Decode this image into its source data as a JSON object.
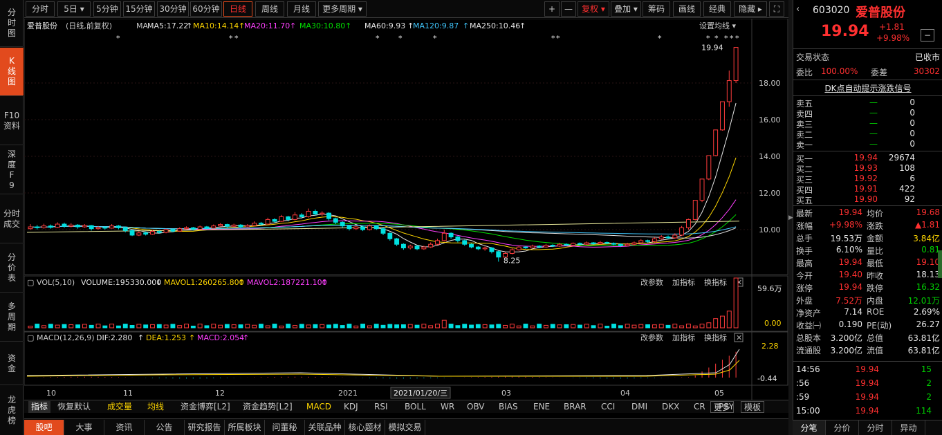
{
  "left_tabs": [
    {
      "label": "分时图"
    },
    {
      "label": "K线图"
    },
    {
      "label": "F10资料"
    },
    {
      "label": "深度F9"
    },
    {
      "label": "分时成交"
    },
    {
      "label": "分价表"
    },
    {
      "label": "多周期"
    },
    {
      "label": "资金"
    },
    {
      "label": "龙虎榜"
    }
  ],
  "periods": [
    {
      "label": "分时"
    },
    {
      "label": "5日 ▾"
    },
    {
      "label": "5分钟"
    },
    {
      "label": "15分钟"
    },
    {
      "label": "30分钟"
    },
    {
      "label": "60分钟"
    },
    {
      "label": "日线"
    },
    {
      "label": "周线"
    },
    {
      "label": "月线"
    },
    {
      "label": "更多周期 ▾"
    }
  ],
  "toolbar": [
    {
      "label": "+"
    },
    {
      "label": "—"
    },
    {
      "label": "复权 ▾"
    },
    {
      "label": "叠加 ▾"
    },
    {
      "label": "筹码"
    },
    {
      "label": "画线"
    },
    {
      "label": "经典"
    },
    {
      "label": "隐藏 ▸"
    },
    {
      "label": "⛶"
    }
  ],
  "kline_header": {
    "name": "爱普股份",
    "mode": "(日线,前复权)",
    "ma_label": "MA",
    "ma": [
      {
        "label": "MA5:17.22",
        "color": "#e6e6e6"
      },
      {
        "label": "MA10:14.14",
        "color": "#ffd700"
      },
      {
        "label": "MA20:11.70",
        "color": "#ff40ff"
      },
      {
        "label": "MA30:10.80",
        "color": "#00e000"
      },
      {
        "label": "MA60:9.93",
        "color": "#e6e6e6"
      },
      {
        "label": "MA120:9.87",
        "color": "#40c8ff"
      },
      {
        "label": "MA250:10.46",
        "color": "#e6e6e6"
      }
    ],
    "setting": "设置均线 ▾"
  },
  "price_axis": [
    "18.00",
    "16.00",
    "14.00",
    "12.00",
    "10.00"
  ],
  "annotations": {
    "high": "19.94",
    "low": "8.25"
  },
  "vol_header": {
    "prefix": "VOL(5,10)",
    "volume": "VOLUME:195330.000",
    "mavol1": "MAVOL1:260265.800",
    "mavol2": "MAVOL2:187221.100",
    "axis_top": "59.6万",
    "axis_bottom": "0.00",
    "actions": [
      "改参数",
      "加指标",
      "换指标"
    ]
  },
  "macd_header": {
    "prefix": "MACD(12,26,9)",
    "dif": "DIF:2.280",
    "dea": "DEA:1.253",
    "macd": "MACD:2.054",
    "axis_top": "2.28",
    "axis_bottom": "-0.44",
    "actions": [
      "改参数",
      "加指标",
      "换指标"
    ]
  },
  "time_axis": [
    "10",
    "11",
    "12",
    "2021",
    "03",
    "04",
    "05"
  ],
  "time_cursor": "2021/01/20/三",
  "chart_data": {
    "type": "candlestick",
    "kline": [
      [
        10.05,
        10.15,
        10.3,
        9.98
      ],
      [
        10.15,
        10.1,
        10.25,
        10.0
      ],
      [
        10.1,
        10.2,
        10.32,
        10.05
      ],
      [
        10.2,
        10.12,
        10.28,
        10.05
      ],
      [
        10.12,
        10.3,
        10.4,
        10.08
      ],
      [
        10.3,
        10.18,
        10.38,
        10.1
      ],
      [
        10.18,
        10.25,
        10.35,
        10.12
      ],
      [
        10.25,
        10.15,
        10.3,
        10.05
      ],
      [
        10.15,
        10.22,
        10.3,
        10.1
      ],
      [
        10.22,
        10.05,
        10.25,
        9.95
      ],
      [
        10.05,
        10.12,
        10.2,
        10.0
      ],
      [
        10.12,
        10.08,
        10.18,
        10.0
      ],
      [
        10.08,
        10.2,
        10.3,
        10.05
      ],
      [
        10.2,
        10.1,
        10.25,
        10.02
      ],
      [
        10.1,
        9.95,
        10.15,
        9.85
      ],
      [
        9.95,
        9.7,
        10.0,
        9.65
      ],
      [
        9.7,
        9.82,
        9.9,
        9.65
      ],
      [
        9.82,
        9.75,
        9.9,
        9.68
      ],
      [
        9.75,
        9.9,
        9.98,
        9.72
      ],
      [
        9.9,
        9.85,
        9.95,
        9.78
      ],
      [
        9.85,
        10.0,
        10.05,
        9.8
      ],
      [
        10.0,
        9.92,
        10.05,
        9.85
      ],
      [
        9.92,
        10.05,
        10.12,
        9.88
      ],
      [
        10.05,
        10.1,
        10.18,
        10.0
      ],
      [
        10.1,
        10.02,
        10.15,
        9.95
      ],
      [
        10.02,
        10.15,
        10.22,
        10.0
      ],
      [
        10.15,
        10.08,
        10.2,
        10.02
      ],
      [
        10.08,
        10.2,
        10.28,
        10.05
      ],
      [
        10.2,
        10.28,
        10.35,
        10.15
      ],
      [
        10.28,
        10.18,
        10.32,
        10.1
      ],
      [
        10.18,
        10.25,
        10.32,
        10.12
      ],
      [
        10.25,
        10.15,
        10.3,
        10.08
      ],
      [
        10.15,
        10.22,
        10.3,
        10.1
      ],
      [
        10.22,
        10.35,
        10.45,
        10.18
      ],
      [
        10.35,
        10.3,
        10.42,
        10.22
      ],
      [
        10.3,
        10.55,
        10.65,
        10.28
      ],
      [
        10.55,
        10.45,
        10.62,
        10.38
      ],
      [
        10.45,
        10.7,
        10.8,
        10.42
      ],
      [
        10.7,
        10.55,
        10.75,
        10.45
      ],
      [
        10.55,
        10.8,
        10.95,
        10.5
      ],
      [
        10.8,
        10.7,
        10.9,
        10.6
      ],
      [
        10.7,
        11.0,
        11.15,
        10.65
      ],
      [
        11.0,
        10.85,
        11.1,
        10.78
      ],
      [
        10.85,
        10.9,
        11.0,
        10.75
      ],
      [
        10.9,
        10.6,
        10.95,
        10.5
      ],
      [
        10.6,
        10.4,
        10.65,
        10.3
      ],
      [
        10.4,
        10.2,
        10.45,
        10.1
      ],
      [
        10.2,
        10.05,
        10.25,
        9.95
      ],
      [
        10.05,
        10.15,
        10.22,
        9.98
      ],
      [
        10.15,
        10.0,
        10.2,
        9.92
      ],
      [
        10.0,
        10.2,
        10.28,
        9.95
      ],
      [
        10.2,
        10.05,
        10.25,
        9.98
      ],
      [
        10.05,
        9.8,
        10.1,
        9.7
      ],
      [
        9.8,
        9.5,
        9.85,
        9.4
      ],
      [
        9.5,
        9.2,
        9.55,
        9.1
      ],
      [
        9.2,
        9.0,
        9.25,
        8.9
      ],
      [
        9.0,
        9.1,
        9.18,
        8.92
      ],
      [
        9.1,
        8.95,
        9.15,
        8.88
      ],
      [
        8.95,
        9.05,
        9.12,
        8.9
      ],
      [
        9.05,
        9.2,
        9.3,
        9.0
      ],
      [
        9.2,
        9.4,
        9.5,
        9.15
      ],
      [
        9.4,
        9.8,
        10.0,
        9.35
      ],
      [
        9.8,
        9.6,
        9.85,
        9.5
      ],
      [
        9.6,
        9.4,
        9.65,
        9.3
      ],
      [
        9.4,
        9.2,
        9.45,
        9.12
      ],
      [
        9.2,
        9.05,
        9.25,
        8.98
      ],
      [
        9.05,
        8.95,
        9.1,
        8.88
      ],
      [
        8.95,
        9.0,
        9.08,
        8.85
      ],
      [
        9.0,
        8.8,
        9.05,
        8.7
      ],
      [
        8.8,
        8.5,
        8.85,
        8.25
      ],
      [
        8.5,
        8.7,
        8.78,
        8.45
      ],
      [
        8.7,
        8.9,
        8.98,
        8.65
      ],
      [
        8.9,
        9.05,
        9.12,
        8.85
      ],
      [
        9.05,
        9.0,
        9.12,
        8.95
      ],
      [
        9.0,
        9.1,
        9.18,
        8.98
      ],
      [
        9.1,
        9.05,
        9.15,
        8.98
      ],
      [
        9.05,
        9.15,
        9.22,
        9.0
      ],
      [
        9.15,
        9.1,
        9.2,
        9.05
      ],
      [
        9.1,
        9.2,
        9.28,
        9.05
      ],
      [
        9.2,
        9.15,
        9.25,
        9.1
      ],
      [
        9.15,
        9.25,
        9.3,
        9.1
      ],
      [
        9.25,
        9.2,
        9.3,
        9.15
      ],
      [
        9.2,
        9.28,
        9.35,
        9.15
      ],
      [
        9.28,
        9.22,
        9.32,
        9.18
      ],
      [
        9.22,
        9.3,
        9.38,
        9.18
      ],
      [
        9.3,
        9.25,
        9.35,
        9.2
      ],
      [
        9.25,
        9.2,
        9.3,
        9.15
      ],
      [
        9.2,
        9.12,
        9.25,
        9.05
      ],
      [
        9.12,
        9.2,
        9.28,
        9.08
      ],
      [
        9.2,
        9.28,
        9.35,
        9.15
      ],
      [
        9.28,
        9.4,
        9.48,
        9.25
      ],
      [
        9.4,
        9.35,
        9.45,
        9.28
      ],
      [
        9.35,
        9.5,
        9.58,
        9.3
      ],
      [
        9.5,
        9.6,
        9.7,
        9.45
      ],
      [
        9.6,
        9.55,
        9.68,
        9.48
      ],
      [
        9.55,
        9.7,
        9.8,
        9.5
      ],
      [
        9.7,
        10.1,
        10.2,
        9.65
      ],
      [
        10.1,
        10.55,
        10.6,
        10.0
      ],
      [
        10.55,
        11.6,
        11.6,
        10.5
      ],
      [
        11.6,
        12.76,
        12.76,
        11.5
      ],
      [
        12.76,
        14.04,
        14.04,
        12.7
      ],
      [
        14.04,
        15.44,
        15.44,
        14.0
      ],
      [
        15.44,
        16.98,
        16.98,
        15.4
      ],
      [
        16.98,
        18.13,
        18.68,
        16.7
      ],
      [
        18.13,
        19.94,
        19.94,
        18.0
      ]
    ],
    "vol_peak": 596000,
    "macd_range": [
      -0.44,
      2.28
    ]
  },
  "quote": {
    "code": "603020",
    "name": "爱普股份",
    "price": "19.94",
    "change": "+1.81",
    "change_pct": "+9.98%",
    "minus_icon_label": "−",
    "status_label": "交易状态",
    "status_value": "已收市",
    "weibi_label": "委比",
    "weibi_value": "100.00%",
    "weicha_label": "委差",
    "weicha_value": "30302",
    "dk_label": "DK点自动提示涨跌信号",
    "sells": [
      {
        "label": "卖五",
        "price": "—",
        "qty": "0"
      },
      {
        "label": "卖四",
        "price": "—",
        "qty": "0"
      },
      {
        "label": "卖三",
        "price": "—",
        "qty": "0"
      },
      {
        "label": "卖二",
        "price": "—",
        "qty": "0"
      },
      {
        "label": "卖一",
        "price": "—",
        "qty": "0"
      }
    ],
    "buys": [
      {
        "label": "买一",
        "price": "19.94",
        "qty": "29674"
      },
      {
        "label": "买二",
        "price": "19.93",
        "qty": "108"
      },
      {
        "label": "买三",
        "price": "19.92",
        "qty": "6"
      },
      {
        "label": "买四",
        "price": "19.91",
        "qty": "422"
      },
      {
        "label": "买五",
        "price": "19.90",
        "qty": "92"
      }
    ],
    "stats": [
      {
        "k": "最新",
        "v": "19.94",
        "vc": "red",
        "k2": "均价",
        "v2": "19.68",
        "v2c": "red"
      },
      {
        "k": "涨幅",
        "v": "+9.98%",
        "vc": "red",
        "k2": "涨跌",
        "v2": "▲1.81",
        "v2c": "red"
      },
      {
        "k": "总手",
        "v": "19.53万",
        "vc": "white",
        "k2": "金额",
        "v2": "3.84亿",
        "v2c": "yellow"
      },
      {
        "k": "换手",
        "v": "6.10%",
        "vc": "white",
        "k2": "量比",
        "v2": "0.81",
        "v2c": "green"
      },
      {
        "k": "最高",
        "v": "19.94",
        "vc": "red",
        "k2": "最低",
        "v2": "19.10",
        "v2c": "red"
      },
      {
        "k": "今开",
        "v": "19.40",
        "vc": "red",
        "k2": "昨收",
        "v2": "18.13",
        "v2c": "white"
      },
      {
        "k": "涨停",
        "v": "19.94",
        "vc": "red",
        "k2": "跌停",
        "v2": "16.32",
        "v2c": "green"
      },
      {
        "k": "外盘",
        "v": "7.52万",
        "vc": "red",
        "k2": "内盘",
        "v2": "12.01万",
        "v2c": "green"
      },
      {
        "k": "净资产",
        "v": "7.14",
        "vc": "white",
        "k2": "ROE",
        "v2": "2.69%",
        "v2c": "white"
      },
      {
        "k": "收益㈠",
        "v": "0.190",
        "vc": "white",
        "k2": "PE(动)",
        "v2": "26.27",
        "v2c": "white"
      },
      {
        "k": "总股本",
        "v": "3.200亿",
        "vc": "white",
        "k2": "总值",
        "v2": "63.81亿",
        "v2c": "white"
      },
      {
        "k": "流通股",
        "v": "3.200亿",
        "vc": "white",
        "k2": "流值",
        "v2": "63.81亿",
        "v2c": "white"
      }
    ],
    "ticks": [
      {
        "t": "14:56",
        "p": "19.94",
        "q": "15"
      },
      {
        "t": ":56",
        "p": "19.94",
        "q": "2"
      },
      {
        "t": ":59",
        "p": "19.94",
        "q": "2"
      },
      {
        "t": "15:00",
        "p": "19.94",
        "q": "114"
      }
    ]
  },
  "indicator_tabs": [
    {
      "label": "指标"
    },
    {
      "label": "恢复默认"
    },
    {
      "label": "成交量"
    },
    {
      "label": "均线"
    },
    {
      "label": "资金博弈[L2]"
    },
    {
      "label": "资金趋势[L2]"
    },
    {
      "label": "MACD"
    },
    {
      "label": "KDJ"
    },
    {
      "label": "RSI"
    },
    {
      "label": "BOLL"
    },
    {
      "label": "WR"
    },
    {
      "label": "OBV"
    },
    {
      "label": "BIAS"
    },
    {
      "label": "ENE"
    },
    {
      "label": "BRAR"
    },
    {
      "label": "CCI"
    },
    {
      "label": "DMI"
    },
    {
      "label": "DKX"
    },
    {
      "label": "CR"
    },
    {
      "label": "PSY"
    },
    {
      "label": "更多"
    },
    {
      "label": "模板"
    }
  ],
  "bottom_tabs": [
    {
      "label": "股吧"
    },
    {
      "label": "大事"
    },
    {
      "label": "资讯"
    },
    {
      "label": "公告"
    },
    {
      "label": "研究报告"
    },
    {
      "label": "所属板块"
    },
    {
      "label": "问董秘"
    },
    {
      "label": "关联品种"
    },
    {
      "label": "核心题材"
    },
    {
      "label": "模拟交易"
    }
  ],
  "right_tabs": [
    {
      "label": "分笔"
    },
    {
      "label": "分价"
    },
    {
      "label": "分时"
    },
    {
      "label": "异动"
    }
  ]
}
